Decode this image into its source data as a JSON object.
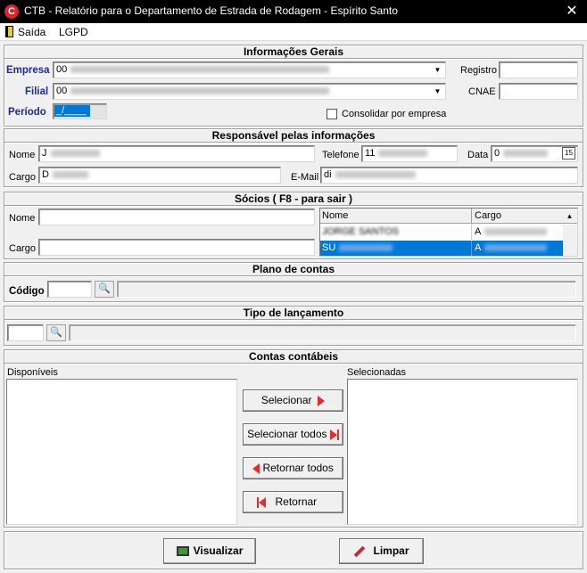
{
  "window": {
    "title": "CTB - Relatório para o Departamento de Estrada de Rodagem - Espírito Santo",
    "icon_letter": "C",
    "close_glyph": "✕"
  },
  "menu": {
    "items": [
      {
        "label": "Saída"
      },
      {
        "label": "LGPD"
      }
    ]
  },
  "info_gerais": {
    "title": "Informações Gerais",
    "empresa_label": "Empresa",
    "empresa_value": "00",
    "filial_label": "Filial",
    "filial_value": "00",
    "periodo_label": "Período",
    "periodo_value": "_/____",
    "registro_label": "Registro",
    "registro_value": "",
    "cnae_label": "CNAE",
    "cnae_value": "",
    "consolidar_label": "Consolidar por empresa",
    "consolidar_checked": false
  },
  "responsavel": {
    "title": "Responsável pelas informações",
    "nome_label": "Nome",
    "nome_value": "J",
    "telefone_label": "Telefone",
    "telefone_value": "11",
    "data_label": "Data",
    "data_value": "0",
    "cargo_label": "Cargo",
    "cargo_value": "D",
    "email_label": "E-Mail",
    "email_value": "di"
  },
  "socios": {
    "title": "Sócios ( F8 - para sair )",
    "nome_label": "Nome",
    "nome_value": "",
    "cargo_label": "Cargo",
    "cargo_value": "",
    "grid_headers": [
      "Nome",
      "Cargo"
    ],
    "rows": [
      {
        "nome": "JORGE SANTOS",
        "cargo": "A",
        "selected": false
      },
      {
        "nome": "SU",
        "cargo": "A",
        "selected": true
      }
    ],
    "selection_color": "#0078d7"
  },
  "plano": {
    "title": "Plano de contas",
    "codigo_label": "Código",
    "codigo_value": "",
    "descricao_value": ""
  },
  "tipo": {
    "title": "Tipo de lançamento",
    "codigo_value": "",
    "descricao_value": ""
  },
  "contas": {
    "title": "Contas contábeis",
    "disponiveis_label": "Disponíveis",
    "selecionadas_label": "Selecionadas",
    "btn_selecionar": "Selecionar",
    "btn_selecionar_todos": "Selecionar todos",
    "btn_retornar_todos": "Retornar todos",
    "btn_retornar": "Retornar"
  },
  "footer": {
    "btn_visualizar": "Visualizar",
    "btn_limpar": "Limpar"
  }
}
